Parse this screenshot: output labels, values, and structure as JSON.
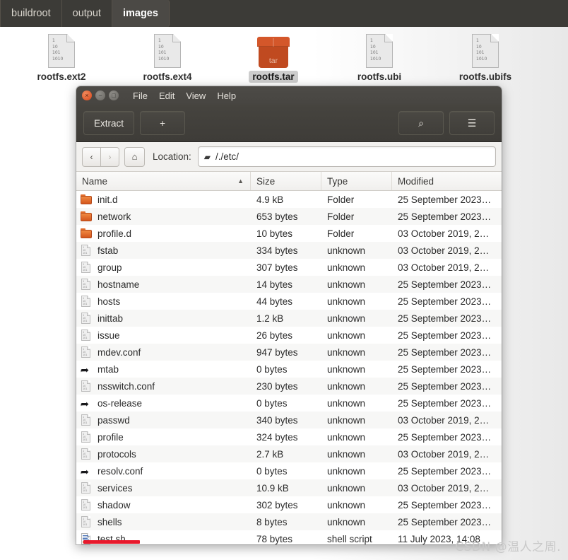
{
  "pathbar": {
    "crumbs": [
      {
        "label": "buildroot",
        "active": false
      },
      {
        "label": "output",
        "active": false
      },
      {
        "label": "images",
        "active": true
      }
    ]
  },
  "desktop_icons": [
    {
      "label": "rootfs.ext2",
      "icon": "binary-file-icon",
      "selected": false,
      "bits": "1\n10\n101\n1010"
    },
    {
      "label": "rootfs.ext4",
      "icon": "binary-file-icon",
      "selected": false,
      "bits": "1\n10\n101\n1010"
    },
    {
      "label": "rootfs.tar",
      "icon": "tar-archive-icon",
      "selected": true,
      "badge": "tar"
    },
    {
      "label": "rootfs.ubi",
      "icon": "binary-file-icon",
      "selected": false,
      "bits": "1\n10\n101\n1010"
    },
    {
      "label": "rootfs.ubifs",
      "icon": "binary-file-icon",
      "selected": false,
      "bits": "1\n10\n101\n1010"
    }
  ],
  "window": {
    "controls": {
      "close": "×",
      "minimize": "−",
      "maximize": "□"
    },
    "menus": [
      "File",
      "Edit",
      "View",
      "Help"
    ],
    "toolbar": {
      "extract_label": "Extract",
      "add_label": "+",
      "search_icon": "⌕",
      "menu_icon": "☰"
    },
    "location": {
      "back_icon": "‹",
      "forward_icon": "›",
      "home_icon": "⌂",
      "label": "Location:",
      "value": "/./etc/",
      "folder_icon": "▰"
    },
    "columns": [
      {
        "label": "Name",
        "sort": "▲"
      },
      {
        "label": "Size",
        "sort": ""
      },
      {
        "label": "Type",
        "sort": ""
      },
      {
        "label": "Modified",
        "sort": ""
      }
    ],
    "files": [
      {
        "name": "init.d",
        "size": "4.9 kB",
        "type": "Folder",
        "modified": "25 September 2023…",
        "icon": "folder-icon"
      },
      {
        "name": "network",
        "size": "653 bytes",
        "type": "Folder",
        "modified": "25 September 2023…",
        "icon": "folder-icon"
      },
      {
        "name": "profile.d",
        "size": "10 bytes",
        "type": "Folder",
        "modified": "03 October 2019, 2…",
        "icon": "folder-icon"
      },
      {
        "name": "fstab",
        "size": "334 bytes",
        "type": "unknown",
        "modified": "03 October 2019, 2…",
        "icon": "binary-file-icon"
      },
      {
        "name": "group",
        "size": "307 bytes",
        "type": "unknown",
        "modified": "03 October 2019, 2…",
        "icon": "binary-file-icon"
      },
      {
        "name": "hostname",
        "size": "14 bytes",
        "type": "unknown",
        "modified": "25 September 2023…",
        "icon": "binary-file-icon"
      },
      {
        "name": "hosts",
        "size": "44 bytes",
        "type": "unknown",
        "modified": "25 September 2023…",
        "icon": "binary-file-icon"
      },
      {
        "name": "inittab",
        "size": "1.2 kB",
        "type": "unknown",
        "modified": "25 September 2023…",
        "icon": "binary-file-icon"
      },
      {
        "name": "issue",
        "size": "26 bytes",
        "type": "unknown",
        "modified": "25 September 2023…",
        "icon": "binary-file-icon"
      },
      {
        "name": "mdev.conf",
        "size": "947 bytes",
        "type": "unknown",
        "modified": "25 September 2023…",
        "icon": "binary-file-icon"
      },
      {
        "name": "mtab",
        "size": "0 bytes",
        "type": "unknown",
        "modified": "25 September 2023…",
        "icon": "symlink-icon"
      },
      {
        "name": "nsswitch.conf",
        "size": "230 bytes",
        "type": "unknown",
        "modified": "25 September 2023…",
        "icon": "binary-file-icon"
      },
      {
        "name": "os-release",
        "size": "0 bytes",
        "type": "unknown",
        "modified": "25 September 2023…",
        "icon": "symlink-icon"
      },
      {
        "name": "passwd",
        "size": "340 bytes",
        "type": "unknown",
        "modified": "03 October 2019, 2…",
        "icon": "binary-file-icon"
      },
      {
        "name": "profile",
        "size": "324 bytes",
        "type": "unknown",
        "modified": "25 September 2023…",
        "icon": "binary-file-icon"
      },
      {
        "name": "protocols",
        "size": "2.7 kB",
        "type": "unknown",
        "modified": "03 October 2019, 2…",
        "icon": "binary-file-icon"
      },
      {
        "name": "resolv.conf",
        "size": "0 bytes",
        "type": "unknown",
        "modified": "25 September 2023…",
        "icon": "symlink-icon"
      },
      {
        "name": "services",
        "size": "10.9 kB",
        "type": "unknown",
        "modified": "03 October 2019, 2…",
        "icon": "binary-file-icon"
      },
      {
        "name": "shadow",
        "size": "302 bytes",
        "type": "unknown",
        "modified": "25 September 2023…",
        "icon": "binary-file-icon"
      },
      {
        "name": "shells",
        "size": "8 bytes",
        "type": "unknown",
        "modified": "25 September 2023…",
        "icon": "binary-file-icon"
      },
      {
        "name": "test.sh",
        "size": "78 bytes",
        "type": "shell script",
        "modified": "11 July 2023, 14:08",
        "icon": "script-icon"
      }
    ]
  },
  "annotations": {
    "watermark": "CSDN @温人之周."
  },
  "colors": {
    "pathbar_bg": "#3c3b37",
    "window_chrome": "#46443f",
    "folder_orange": "#d4561c",
    "accent_red": "#e8192c"
  }
}
